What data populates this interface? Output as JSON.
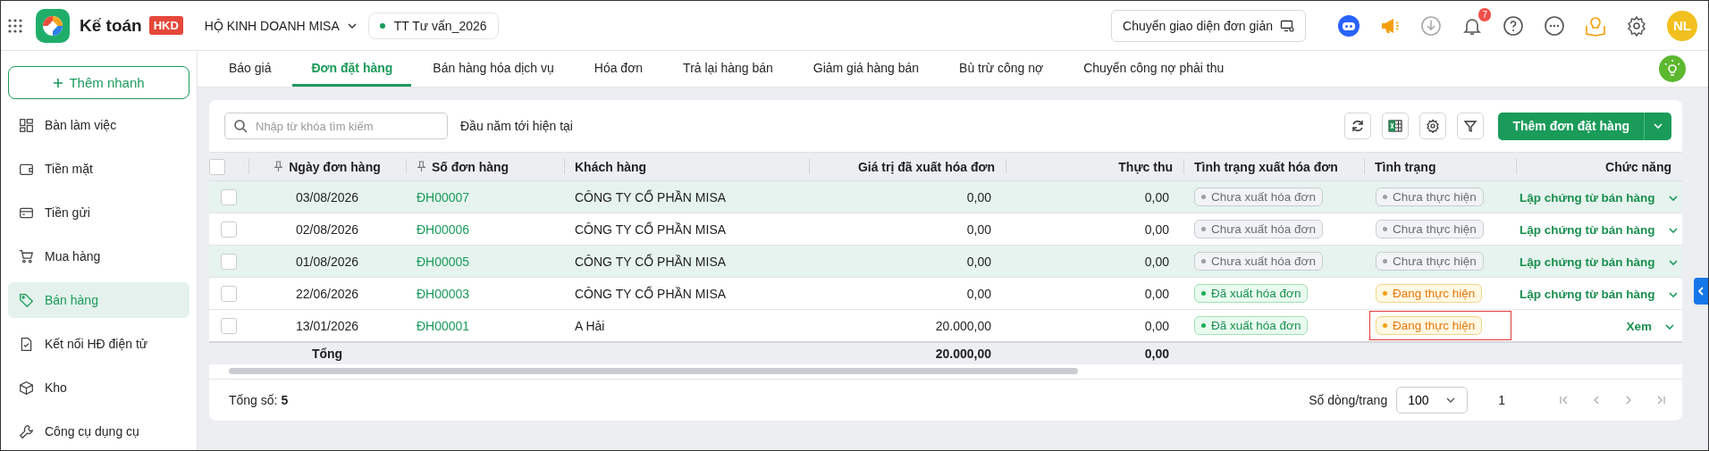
{
  "app": {
    "name": "Kế toán",
    "badge": "HKD"
  },
  "company": "HỘ KINH DOANH MISA",
  "workspace": "TT Tư vấn_2026",
  "switch_button": "Chuyển giao diện đơn giản",
  "notifications": {
    "count": "7"
  },
  "user": {
    "initials": "NL"
  },
  "sidebar": {
    "quick_add": "Thêm nhanh",
    "items": [
      {
        "label": "Bàn làm việc",
        "selected": false
      },
      {
        "label": "Tiền mặt",
        "selected": false
      },
      {
        "label": "Tiền gửi",
        "selected": false
      },
      {
        "label": "Mua hàng",
        "selected": false
      },
      {
        "label": "Bán hàng",
        "selected": true
      },
      {
        "label": "Kết nối HĐ điện tử",
        "selected": false
      },
      {
        "label": "Kho",
        "selected": false
      },
      {
        "label": "Công cụ dụng cụ",
        "selected": false
      }
    ]
  },
  "tabs": [
    {
      "label": "Báo giá",
      "selected": false
    },
    {
      "label": "Đơn đặt hàng",
      "selected": true
    },
    {
      "label": "Bán hàng hóa dịch vụ",
      "selected": false
    },
    {
      "label": "Hóa đơn",
      "selected": false
    },
    {
      "label": "Trả lại hàng bán",
      "selected": false
    },
    {
      "label": "Giảm giá hàng bán",
      "selected": false
    },
    {
      "label": "Bù trừ công nợ",
      "selected": false
    },
    {
      "label": "Chuyển công nợ phải thu",
      "selected": false
    }
  ],
  "toolbar": {
    "search_placeholder": "Nhập từ khóa tìm kiếm",
    "period": "Đầu năm tới hiện tại",
    "add_button": "Thêm đơn đặt hàng"
  },
  "table": {
    "all_checked": false,
    "columns": [
      {
        "label": "Ngày đơn hàng",
        "pinned": true
      },
      {
        "label": "Số đơn hàng",
        "pinned": true
      },
      {
        "label": "Khách hàng",
        "pinned": false
      },
      {
        "label": "Giá trị đã xuất hóa đơn",
        "pinned": false
      },
      {
        "label": "Thực thu",
        "pinned": false
      },
      {
        "label": "Tình trạng xuất hóa đơn",
        "pinned": false
      },
      {
        "label": "Tình trạng",
        "pinned": false
      },
      {
        "label": "Chức năng",
        "pinned": false
      }
    ],
    "rows": [
      {
        "date": "03/08/2026",
        "number": "ĐH00007",
        "customer": "CÔNG TY CỔ PHẦN MISA",
        "invoiced_value": "0,00",
        "received": "0,00",
        "invoice_status": {
          "label": "Chưa xuất hóa đơn",
          "kind": "pending"
        },
        "status": {
          "label": "Chưa thực hiện",
          "kind": "pending"
        },
        "action": "Lập chứng từ bán hàng",
        "checked": false,
        "highlighted": true,
        "outlined": false
      },
      {
        "date": "02/08/2026",
        "number": "ĐH00006",
        "customer": "CÔNG TY CỔ PHẦN MISA",
        "invoiced_value": "0,00",
        "received": "0,00",
        "invoice_status": {
          "label": "Chưa xuất hóa đơn",
          "kind": "pending"
        },
        "status": {
          "label": "Chưa thực hiện",
          "kind": "pending"
        },
        "action": "Lập chứng từ bán hàng",
        "checked": false,
        "highlighted": false,
        "outlined": false
      },
      {
        "date": "01/08/2026",
        "number": "ĐH00005",
        "customer": "CÔNG TY CỔ PHẦN MISA",
        "invoiced_value": "0,00",
        "received": "0,00",
        "invoice_status": {
          "label": "Chưa xuất hóa đơn",
          "kind": "pending"
        },
        "status": {
          "label": "Chưa thực hiện",
          "kind": "pending"
        },
        "action": "Lập chứng từ bán hàng",
        "checked": false,
        "highlighted": true,
        "outlined": false
      },
      {
        "date": "22/06/2026",
        "number": "ĐH00003",
        "customer": "CÔNG TY CỔ PHẦN MISA",
        "invoiced_value": "0,00",
        "received": "0,00",
        "invoice_status": {
          "label": "Đã xuất hóa đơn",
          "kind": "done"
        },
        "status": {
          "label": "Đang thực hiện",
          "kind": "progress"
        },
        "action": "Lập chứng từ bán hàng",
        "checked": false,
        "highlighted": false,
        "outlined": false
      },
      {
        "date": "13/01/2026",
        "number": "ĐH00001",
        "customer": "A Hải",
        "invoiced_value": "20.000,00",
        "received": "0,00",
        "invoice_status": {
          "label": "Đã xuất hóa đơn",
          "kind": "done"
        },
        "status": {
          "label": "Đang thực hiện",
          "kind": "progress"
        },
        "action": "Xem",
        "checked": false,
        "highlighted": false,
        "outlined": true
      }
    ],
    "total": {
      "label": "Tổng",
      "invoiced_value": "20.000,00",
      "received": "0,00"
    }
  },
  "footer": {
    "total_label": "Tổng số:",
    "total_count": "5",
    "page_size_label": "Số dòng/trang",
    "page_size": "100",
    "page": "1"
  }
}
